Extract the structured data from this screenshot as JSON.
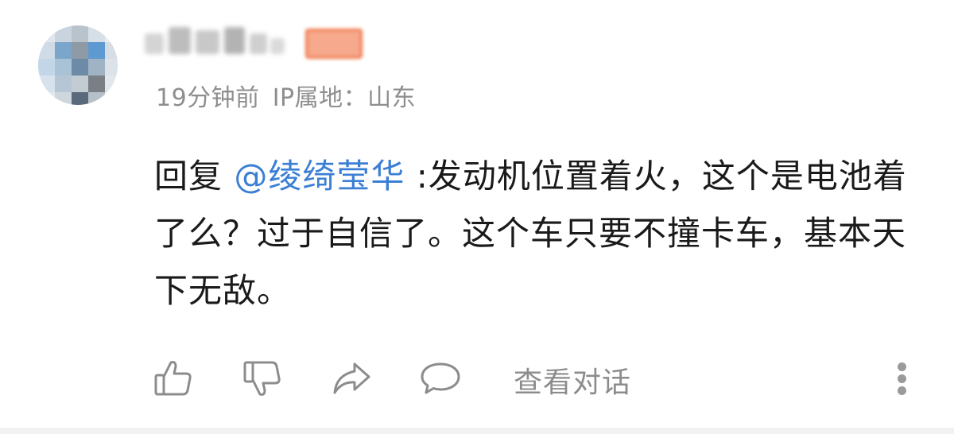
{
  "comment": {
    "avatar_icon": "user-avatar-mosaic",
    "username_obscured": true,
    "meta": {
      "time": "19分钟前",
      "ip_location": "IP属地：山东"
    },
    "body": {
      "reply_prefix": "回复 ",
      "mention": "@绫绮莹华",
      "text": " :发动机位置着火，这个是电池着了么？过于自信了。这个车只要不撞卡车，基本天下无敌。"
    },
    "actions": {
      "like_icon": "thumbs-up-icon",
      "dislike_icon": "thumbs-down-icon",
      "share_icon": "share-icon",
      "reply_icon": "comment-bubble-icon",
      "view_conversation": "查看对话",
      "more_icon": "more-vertical-icon"
    }
  },
  "colors": {
    "mention": "#3b7fd5",
    "meta_text": "#8e8e8e",
    "icon": "#8c8c8c",
    "badge": "#f0764a"
  }
}
